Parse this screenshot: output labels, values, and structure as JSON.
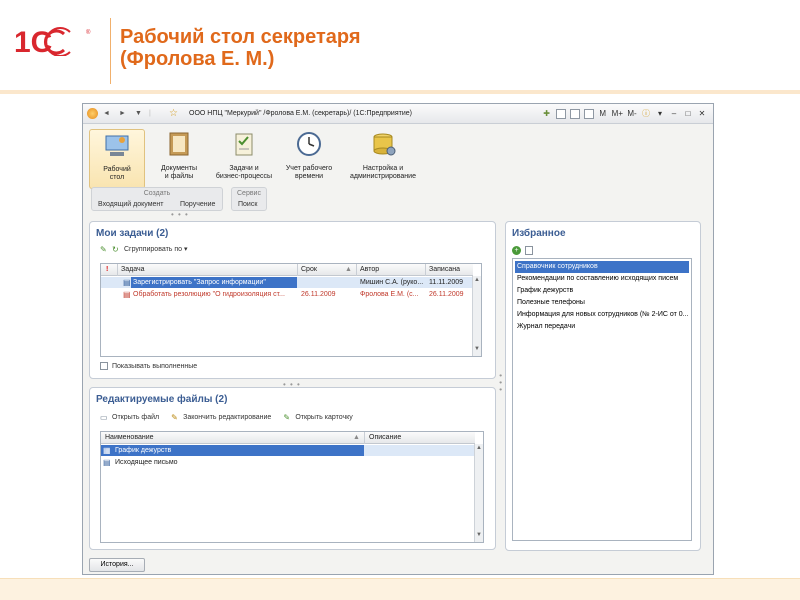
{
  "slide": {
    "title_line1": "Рабочий стол секретаря",
    "title_line2": "(Фролова Е. М.)"
  },
  "window": {
    "title": "ООО НПЦ \"Меркурий\" /Фролова Е.М. (секретарь)/  (1С:Предприятие)",
    "buttons": [
      "M",
      "M+",
      "M-"
    ]
  },
  "sections": [
    {
      "label": "Рабочий\nстол",
      "icon": "desktop-icon",
      "active": true
    },
    {
      "label": "Документы\nи файлы",
      "icon": "documents-icon"
    },
    {
      "label": "Задачи и\nбизнес-процессы",
      "icon": "tasks-icon"
    },
    {
      "label": "Учет рабочего\nвремени",
      "icon": "clock-icon"
    },
    {
      "label": "Настройка и\nадминистрирование",
      "icon": "settings-icon"
    }
  ],
  "commands": {
    "create": {
      "header": "Создать",
      "items": [
        "Входящий документ",
        "Поручение"
      ]
    },
    "service": {
      "header": "Сервис",
      "items": [
        "Поиск"
      ]
    }
  },
  "tasks": {
    "title": "Мои задачи (2)",
    "group_by": "Сгруппировать по",
    "columns": [
      "!",
      "Задача",
      "Срок",
      "Автор",
      "Записана"
    ],
    "rows": [
      {
        "task": "Зарегистрировать \"Запрос информации\"",
        "deadline": "",
        "author": "Мишин С.А. (руко...",
        "written": "11.11.2009",
        "selected": true
      },
      {
        "task": "Обработать резолюцию \"О гидроизоляция ст...",
        "deadline": "26.11.2009",
        "author": "Фролова Е.М. (с...",
        "written": "26.11.2009",
        "overdue": true
      }
    ],
    "show_completed": "Показывать выполненные"
  },
  "files": {
    "title": "Редактируемые файлы (2)",
    "toolbar": [
      "Открыть файл",
      "Закончить редактирование",
      "Открыть карточку"
    ],
    "columns": [
      "Наименование",
      "Описание"
    ],
    "rows": [
      {
        "name": "График дежурств",
        "description": "",
        "selected": true
      },
      {
        "name": "Исходящее письмо",
        "description": ""
      }
    ]
  },
  "favorites": {
    "title": "Избранное",
    "items": [
      "Справочник сотрудников",
      "Рекомендации по составлению исходящих писем",
      "График дежурств",
      "Полезные телефоны",
      "Информация для новых сотрудников (№ 2-ИС от 0...",
      "Журнал передачи"
    ]
  },
  "footer": {
    "history": "История..."
  },
  "colors": {
    "title": "#e0691b",
    "accent_blue": "#3b5d93",
    "selection": "#3d73c7"
  }
}
